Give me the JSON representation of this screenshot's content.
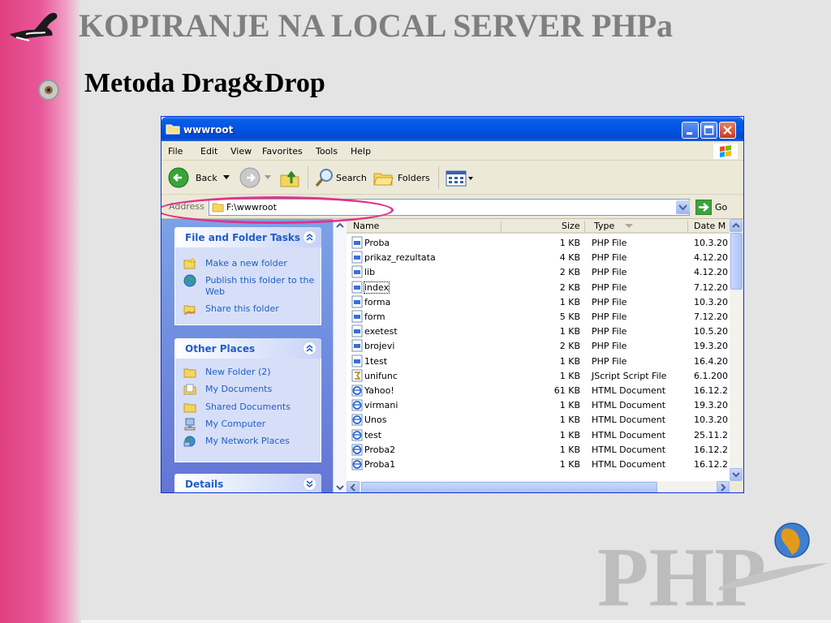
{
  "slide": {
    "title": "KOPIRANJE NA LOCAL SERVER PHPa",
    "subtitle": "Metoda Drag&Drop",
    "logo_text": "PHP"
  },
  "window": {
    "title": "wwwroot",
    "menu": [
      "File",
      "Edit",
      "View",
      "Favorites",
      "Tools",
      "Help"
    ],
    "toolbar": {
      "back": "Back",
      "search": "Search",
      "folders": "Folders"
    },
    "address": {
      "label": "Address",
      "value": "F:\\wwwroot",
      "go": "Go"
    }
  },
  "taskpane": {
    "file_tasks": {
      "header": "File and Folder Tasks",
      "items": [
        {
          "label": "Make a new folder",
          "icon": "new-folder-icon"
        },
        {
          "label": "Publish this folder to the Web",
          "icon": "publish-web-icon"
        },
        {
          "label": "Share this folder",
          "icon": "share-folder-icon"
        }
      ]
    },
    "other_places": {
      "header": "Other Places",
      "items": [
        {
          "label": "New Folder (2)",
          "icon": "folder-icon"
        },
        {
          "label": "My Documents",
          "icon": "my-documents-icon"
        },
        {
          "label": "Shared Documents",
          "icon": "shared-documents-icon"
        },
        {
          "label": "My Computer",
          "icon": "my-computer-icon"
        },
        {
          "label": "My Network Places",
          "icon": "network-places-icon"
        }
      ]
    },
    "details": {
      "header": "Details"
    }
  },
  "filelist": {
    "columns": {
      "name": "Name",
      "size": "Size",
      "type": "Type",
      "date": "Date M"
    },
    "files": [
      {
        "name": "Proba",
        "size": "1 KB",
        "type": "PHP File",
        "date": "10.3.20",
        "kind": "php"
      },
      {
        "name": "prikaz_rezultata",
        "size": "4 KB",
        "type": "PHP File",
        "date": "4.12.20",
        "kind": "php"
      },
      {
        "name": "lib",
        "size": "2 KB",
        "type": "PHP File",
        "date": "4.12.20",
        "kind": "php"
      },
      {
        "name": "index",
        "size": "2 KB",
        "type": "PHP File",
        "date": "7.12.20",
        "kind": "php",
        "selected": true
      },
      {
        "name": "forma",
        "size": "1 KB",
        "type": "PHP File",
        "date": "10.3.20",
        "kind": "php"
      },
      {
        "name": "form",
        "size": "5 KB",
        "type": "PHP File",
        "date": "7.12.20",
        "kind": "php"
      },
      {
        "name": "exetest",
        "size": "1 KB",
        "type": "PHP File",
        "date": "10.5.20",
        "kind": "php"
      },
      {
        "name": "brojevi",
        "size": "2 KB",
        "type": "PHP File",
        "date": "19.3.20",
        "kind": "php"
      },
      {
        "name": "1test",
        "size": "1 KB",
        "type": "PHP File",
        "date": "16.4.20",
        "kind": "php"
      },
      {
        "name": "unifunc",
        "size": "1 KB",
        "type": "JScript Script File",
        "date": "6.1.200",
        "kind": "js"
      },
      {
        "name": "Yahoo!",
        "size": "61 KB",
        "type": "HTML Document",
        "date": "16.12.2",
        "kind": "html"
      },
      {
        "name": "virmani",
        "size": "1 KB",
        "type": "HTML Document",
        "date": "19.3.20",
        "kind": "html"
      },
      {
        "name": "Unos",
        "size": "1 KB",
        "type": "HTML Document",
        "date": "10.3.20",
        "kind": "html"
      },
      {
        "name": "test",
        "size": "1 KB",
        "type": "HTML Document",
        "date": "25.11.2",
        "kind": "html"
      },
      {
        "name": "Proba2",
        "size": "1 KB",
        "type": "HTML Document",
        "date": "16.12.2",
        "kind": "html"
      },
      {
        "name": "Proba1",
        "size": "1 KB",
        "type": "HTML Document",
        "date": "16.12.2",
        "kind": "html"
      }
    ]
  },
  "colors": {
    "accent_pink": "#e0338d",
    "xp_blue": "#0054e3",
    "task_link": "#215dc6"
  }
}
